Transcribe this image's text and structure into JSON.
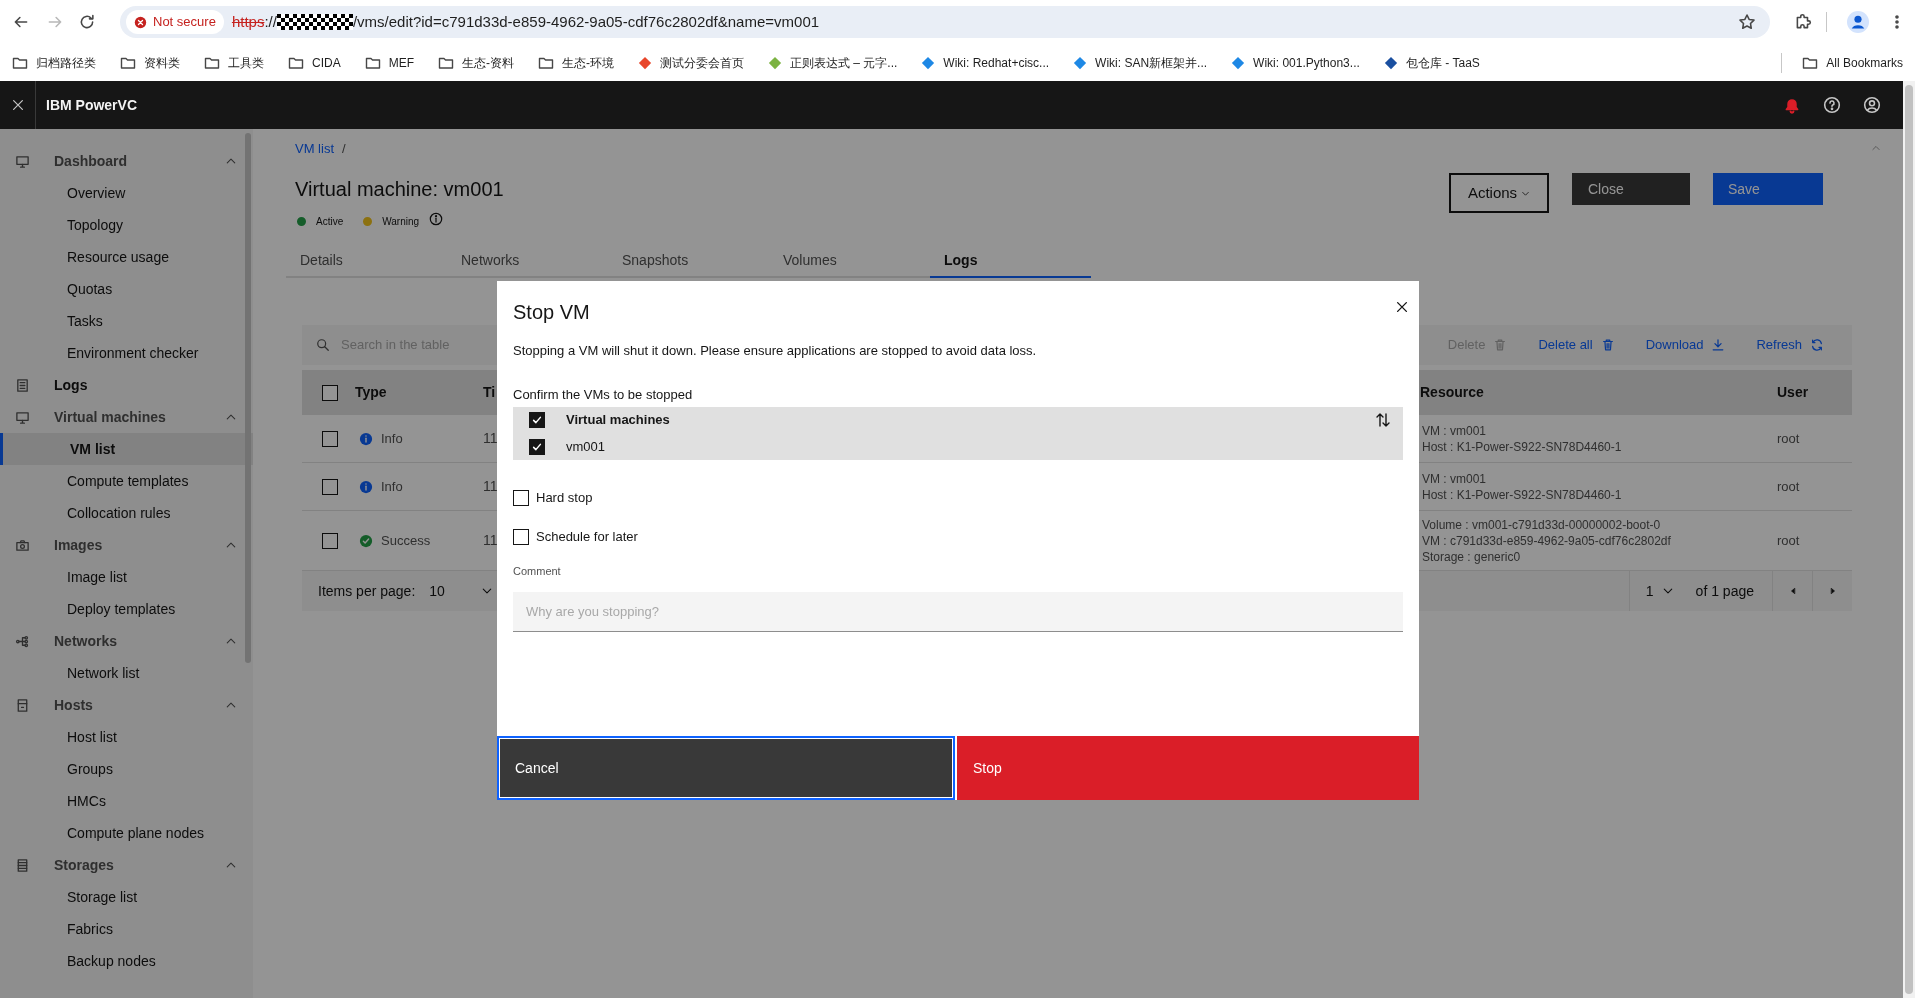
{
  "browser": {
    "not_secure": "Not secure",
    "url": {
      "scheme": "https",
      "after_scheme": "://",
      "path": "/vms/edit?id=c791d33d-e859-4962-9a05-cdf76c2802df&name=vm001"
    },
    "bookmarks": [
      {
        "label": "归档路径类",
        "kind": "folder"
      },
      {
        "label": "资料类",
        "kind": "folder"
      },
      {
        "label": "工具类",
        "kind": "folder"
      },
      {
        "label": "CIDA",
        "kind": "folder"
      },
      {
        "label": "MEF",
        "kind": "folder"
      },
      {
        "label": "生态-资料",
        "kind": "folder"
      },
      {
        "label": "生态-环境",
        "kind": "folder"
      },
      {
        "label": "测试分委会首页",
        "kind": "site",
        "color": "#e8462b"
      },
      {
        "label": "正则表达式 – 元字...",
        "kind": "site",
        "color": "#7cb342"
      },
      {
        "label": "Wiki: Redhat+cisc...",
        "kind": "site",
        "color": "#1e88e5"
      },
      {
        "label": "Wiki: SAN新框架并...",
        "kind": "site",
        "color": "#1e88e5"
      },
      {
        "label": "Wiki: 001.Python3...",
        "kind": "site",
        "color": "#1e88e5"
      },
      {
        "label": "包仓库 - TaaS",
        "kind": "site",
        "color": "#1a4fa0"
      }
    ],
    "all_bookmarks": "All Bookmarks"
  },
  "app": {
    "title": "IBM PowerVC"
  },
  "sidebar": {
    "items": [
      {
        "label": "Dashboard",
        "expanded": true,
        "selected": false,
        "children": [
          {
            "label": "Overview",
            "selected": false
          },
          {
            "label": "Topology",
            "selected": false
          },
          {
            "label": "Resource usage",
            "selected": false
          },
          {
            "label": "Quotas",
            "selected": false
          },
          {
            "label": "Tasks",
            "selected": false
          },
          {
            "label": "Environment checker",
            "selected": false
          }
        ]
      },
      {
        "label": "Logs",
        "selected": false
      },
      {
        "label": "Virtual machines",
        "expanded": true,
        "selected": false,
        "children": [
          {
            "label": "VM list",
            "selected": true
          },
          {
            "label": "Compute templates",
            "selected": false
          },
          {
            "label": "Collocation rules",
            "selected": false
          }
        ]
      },
      {
        "label": "Images",
        "expanded": true,
        "selected": false,
        "children": [
          {
            "label": "Image list",
            "selected": false
          },
          {
            "label": "Deploy templates",
            "selected": false
          }
        ]
      },
      {
        "label": "Networks",
        "expanded": true,
        "selected": false,
        "children": [
          {
            "label": "Network list",
            "selected": false
          }
        ]
      },
      {
        "label": "Hosts",
        "expanded": true,
        "selected": false,
        "children": [
          {
            "label": "Host list",
            "selected": false
          },
          {
            "label": "Groups",
            "selected": false
          },
          {
            "label": "HMCs",
            "selected": false
          },
          {
            "label": "Compute plane nodes",
            "selected": false
          }
        ]
      },
      {
        "label": "Storages",
        "expanded": true,
        "selected": false,
        "children": [
          {
            "label": "Storage list",
            "selected": false
          },
          {
            "label": "Fabrics",
            "selected": false
          },
          {
            "label": "Backup nodes",
            "selected": false
          }
        ]
      }
    ]
  },
  "page": {
    "breadcrumb": {
      "link": "VM list",
      "separator": "/"
    },
    "title": "Virtual machine: vm001",
    "statuses": [
      {
        "label": "Active",
        "color": "#155d2a"
      },
      {
        "label": "Warning",
        "color": "#8c7110"
      }
    ],
    "buttons": {
      "actions": "Actions",
      "close": "Close",
      "save": "Save"
    },
    "tabs": [
      {
        "label": "Details",
        "selected": false
      },
      {
        "label": "Networks",
        "selected": false
      },
      {
        "label": "Snapshots",
        "selected": false
      },
      {
        "label": "Volumes",
        "selected": false
      },
      {
        "label": "Logs",
        "selected": true
      }
    ],
    "table": {
      "search_placeholder": "Search in the table",
      "actions": [
        {
          "label": "Delete",
          "kind": "delete",
          "disabled": true
        },
        {
          "label": "Delete all",
          "kind": "delete",
          "disabled": false
        },
        {
          "label": "Download",
          "kind": "download",
          "disabled": false
        },
        {
          "label": "Refresh",
          "kind": "refresh",
          "disabled": false
        }
      ],
      "all_checked": false,
      "columns": [
        "Type",
        "Ti",
        "Resource",
        "User"
      ],
      "rows": [
        {
          "checked": false,
          "kind": "info",
          "type": "Info",
          "column_3": "11",
          "resource": [
            "VM : vm001",
            "Host : K1-Power-S922-SN78D4460-1"
          ],
          "user": "root"
        },
        {
          "checked": false,
          "kind": "info",
          "type": "Info",
          "column_3": "11",
          "resource": [
            "VM : vm001",
            "Host : K1-Power-S922-SN78D4460-1"
          ],
          "user": "root"
        },
        {
          "checked": false,
          "kind": "success",
          "type": "Success",
          "column_3": "11",
          "resource": [
            "Volume : vm001-c791d33d-00000002-boot-0",
            "VM : c791d33d-e859-4962-9a05-cdf76c2802df",
            "Storage : generic0"
          ],
          "user": "root"
        }
      ],
      "pagination": {
        "items_label": "Items per page:",
        "items_value": "10",
        "page": "1",
        "of_pages": "of 1 page"
      }
    }
  },
  "dialog": {
    "title": "Stop VM",
    "description": "Stopping a VM will shut it down. Please ensure applications are stopped to avoid data loss.",
    "confirm_label": "Confirm the VMs to be stopped",
    "vm_table": {
      "column": "Virtual machines",
      "all_checked": true,
      "rows": [
        {
          "name": "vm001",
          "checked": true
        }
      ]
    },
    "options": [
      {
        "label": "Hard stop",
        "checked": false
      },
      {
        "label": "Schedule for later",
        "checked": false
      }
    ],
    "comment": {
      "label": "Comment",
      "placeholder": "Why are you stopping?"
    },
    "buttons": [
      {
        "label": "Cancel",
        "kind": "secondary",
        "focused": true
      },
      {
        "label": "Stop",
        "kind": "danger",
        "focused": false
      }
    ]
  }
}
